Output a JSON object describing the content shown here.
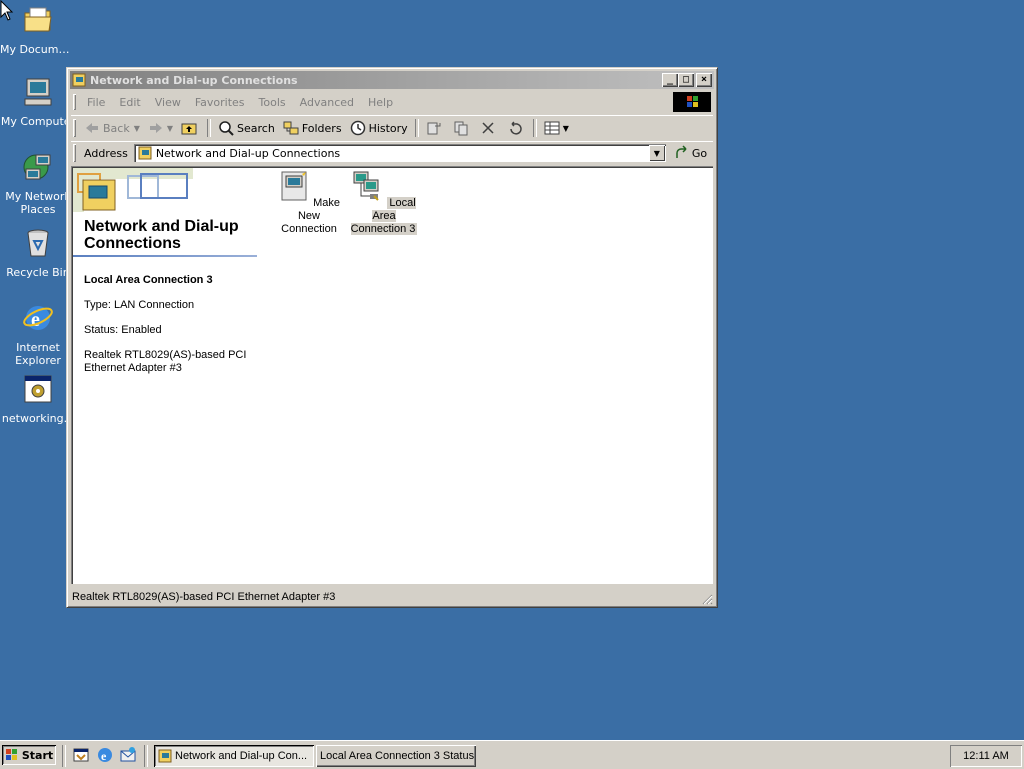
{
  "desktop": {
    "icons": [
      {
        "label": "My Documents"
      },
      {
        "label": "My Computer"
      },
      {
        "label": "My Network Places"
      },
      {
        "label": "Recycle Bin"
      },
      {
        "label": "Internet Explorer"
      },
      {
        "label": "networking..."
      }
    ]
  },
  "window": {
    "title": "Network and Dial-up Connections",
    "menu": [
      "File",
      "Edit",
      "View",
      "Favorites",
      "Tools",
      "Advanced",
      "Help"
    ],
    "toolbar": {
      "back": "Back",
      "search": "Search",
      "folders": "Folders",
      "history": "History"
    },
    "address": {
      "label": "Address",
      "value": "Network and Dial-up Connections",
      "go": "Go"
    },
    "panel": {
      "title": "Network and Dial-up Connections",
      "selected_name": "Local Area Connection 3",
      "type": "Type: LAN Connection",
      "status": "Status: Enabled",
      "device": "Realtek RTL8029(AS)-based PCI Ethernet Adapter #3"
    },
    "items": [
      {
        "label": "Make New Connection",
        "selected": false
      },
      {
        "label": "Local Area Connection 3",
        "selected": true
      }
    ],
    "statusbar": "Realtek RTL8029(AS)-based PCI Ethernet Adapter #3"
  },
  "taskbar": {
    "start": "Start",
    "tasks": [
      {
        "label": "Network and Dial-up Con..."
      },
      {
        "label": "Local Area Connection 3 Status"
      }
    ],
    "clock": "12:11 AM"
  },
  "colors": {
    "desktop": "#3a6ea5",
    "face": "#d4d0c8",
    "inactive_title": "#808080"
  }
}
